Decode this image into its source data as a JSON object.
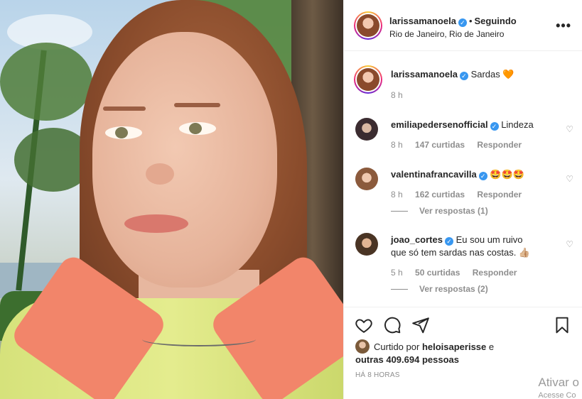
{
  "post": {
    "author": "larissamanoela",
    "follow_status": "Seguindo",
    "separator": "•",
    "location": "Rio de Janeiro, Rio de Janeiro",
    "more_label": "•••"
  },
  "caption": {
    "username": "larissamanoela",
    "text": "Sardas",
    "emoji": "🧡",
    "time": "8 h"
  },
  "comments": [
    {
      "username": "emiliapedersenofficial",
      "verified": true,
      "text": "Lindeza",
      "time": "8 h",
      "likes": "147 curtidas",
      "reply_label": "Responder",
      "view_replies": ""
    },
    {
      "username": "valentinafrancavilla",
      "verified": true,
      "text": "🤩🤩🤩",
      "time": "8 h",
      "likes": "162 curtidas",
      "reply_label": "Responder",
      "view_replies": "Ver respostas (1)"
    },
    {
      "username": "joao_cortes",
      "verified": true,
      "text": "Eu sou um ruivo que só tem sardas nas costas. 👍🏼",
      "time": "5 h",
      "likes": "50 curtidas",
      "reply_label": "Responder",
      "view_replies": "Ver respostas (2)"
    }
  ],
  "likes_summary": {
    "prefix": "Curtido por",
    "user": "heloisaperisse",
    "and": "e",
    "others": "outras 409.694 pessoas"
  },
  "timestamp": "HÁ 8 HORAS",
  "watermark": {
    "line1": "Ativar o",
    "line2": "Acesse Co"
  },
  "icons": [
    "heart-icon",
    "comment-icon",
    "share-icon",
    "bookmark-icon",
    "verified-icon",
    "more-icon"
  ],
  "colors": {
    "verified": "#3897f0",
    "text": "#262626",
    "meta": "#8e8e8e",
    "border": "#efefef"
  }
}
